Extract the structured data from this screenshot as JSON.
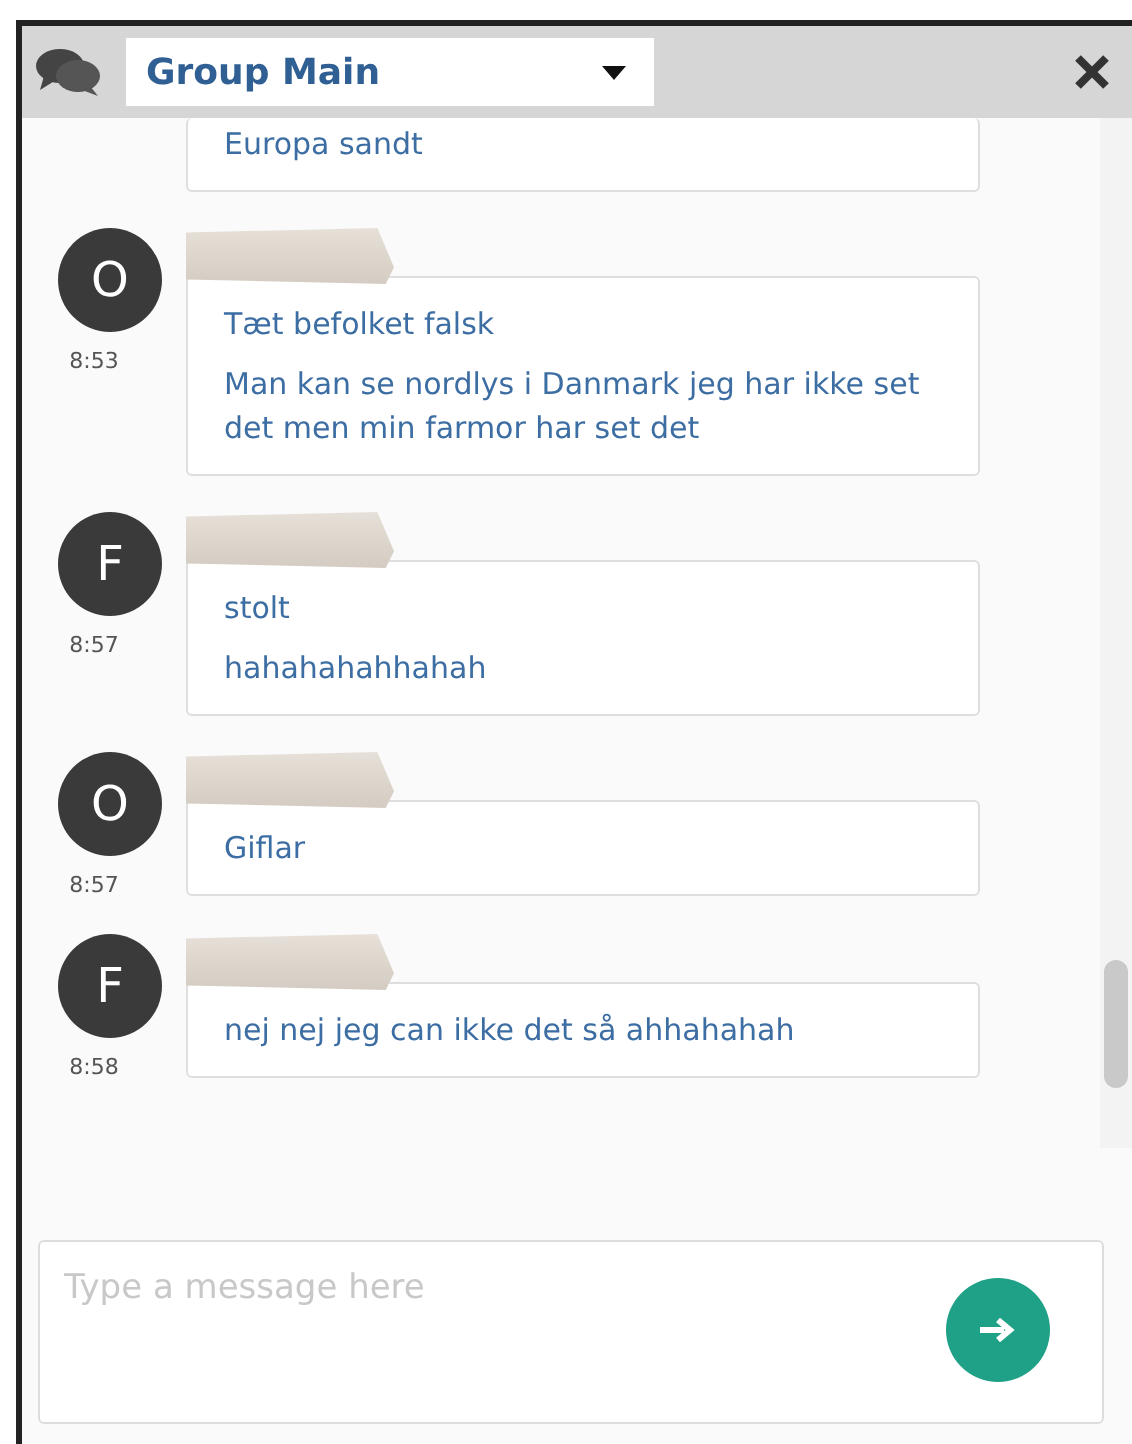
{
  "header": {
    "group": "Group Main"
  },
  "messages": [
    {
      "cut_off": true,
      "lines": [
        "Europa sandt"
      ]
    },
    {
      "cut_off": false,
      "initial": "O",
      "time": "8:53",
      "lines": [
        "Tæt befolket falsk",
        "Man kan se nordlys i Danmark jeg har ikke set det men min farmor har set det"
      ]
    },
    {
      "cut_off": false,
      "initial": "F",
      "time": "8:57",
      "lines": [
        "stolt",
        "hahahahahhahah"
      ]
    },
    {
      "cut_off": false,
      "initial": "O",
      "time": "8:57",
      "lines": [
        "Giflar"
      ]
    },
    {
      "cut_off": false,
      "initial": "F",
      "time": "8:58",
      "lines": [
        "nej nej jeg can ikke det så ahhahahah"
      ]
    }
  ],
  "composer": {
    "placeholder": "Type a message here"
  }
}
